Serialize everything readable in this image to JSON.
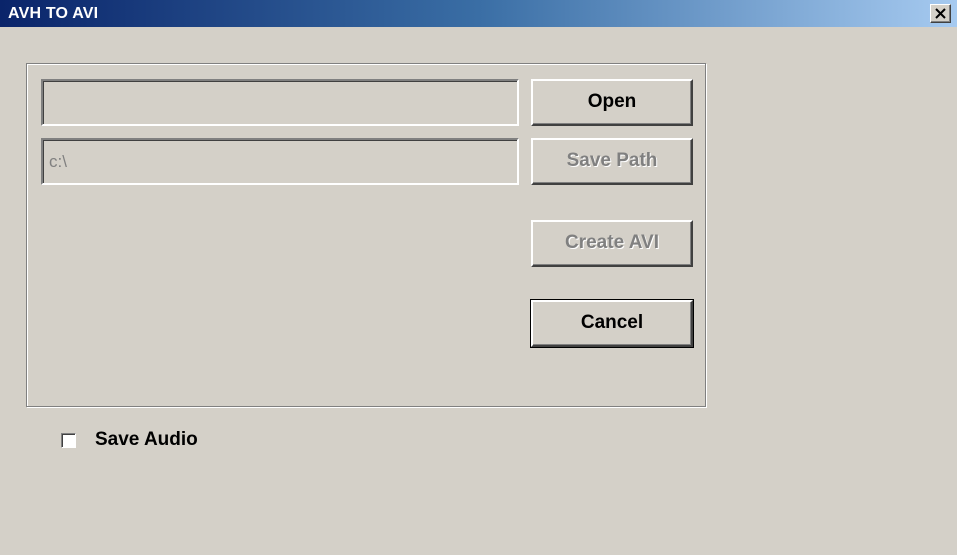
{
  "window": {
    "title": "AVH TO AVI",
    "close_label": "close"
  },
  "form": {
    "source_path": "",
    "save_path": "c:\\"
  },
  "buttons": {
    "open": "Open",
    "save_path": "Save Path",
    "create_avi": "Create AVI",
    "cancel": "Cancel"
  },
  "options": {
    "save_audio_label": "Save Audio",
    "save_audio_checked": false
  },
  "icons": {
    "close": "close-icon"
  },
  "colors": {
    "window_bg": "#d4d0c8",
    "title_gradient_start": "#0a246a",
    "title_gradient_end": "#a6caf0",
    "disabled_text": "#808080"
  }
}
